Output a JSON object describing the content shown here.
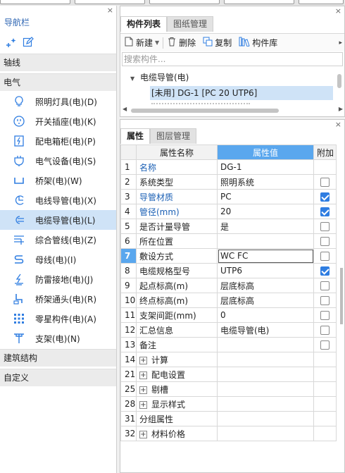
{
  "left_panel": {
    "title": "导航栏",
    "close": "×",
    "categories": {
      "axis": "轴线",
      "electric": "电气",
      "structure": "建筑结构",
      "custom": "自定义"
    },
    "items": [
      {
        "label": "照明灯具(电)(D)",
        "icon": "light-bulb-icon"
      },
      {
        "label": "开关插座(电)(K)",
        "icon": "switch-socket-icon"
      },
      {
        "label": "配电箱柜(电)(P)",
        "icon": "distribution-box-icon"
      },
      {
        "label": "电气设备(电)(S)",
        "icon": "electrical-equipment-icon"
      },
      {
        "label": "桥架(电)(W)",
        "icon": "cable-tray-icon"
      },
      {
        "label": "电线导管(电)(X)",
        "icon": "wire-conduit-icon"
      },
      {
        "label": "电缆导管(电)(L)",
        "icon": "cable-conduit-icon"
      },
      {
        "label": "综合管线(电)(Z)",
        "icon": "integrated-pipeline-icon"
      },
      {
        "label": "母线(电)(I)",
        "icon": "busbar-icon"
      },
      {
        "label": "防雷接地(电)(J)",
        "icon": "lightning-ground-icon"
      },
      {
        "label": "桥架通头(电)(R)",
        "icon": "tray-fitting-icon"
      },
      {
        "label": "零星构件(电)(A)",
        "icon": "misc-component-icon"
      },
      {
        "label": "支架(电)(N)",
        "icon": "bracket-icon"
      }
    ],
    "selected_index": 6
  },
  "component_panel": {
    "tabs": [
      "构件列表",
      "图纸管理"
    ],
    "active_tab": 0,
    "toolbar": {
      "new": "新建",
      "delete": "删除",
      "copy": "复制",
      "library": "构件库"
    },
    "search_placeholder": "搜索构件...",
    "tree_root": "电缆导管(电)",
    "tree_selected": "[未用] DG-1 [PC 20 UTP6]"
  },
  "property_panel": {
    "tabs": [
      "属性",
      "图层管理"
    ],
    "active_tab": 0,
    "headers": {
      "name": "属性名称",
      "value": "属性值",
      "extra": "附加"
    },
    "rows": [
      {
        "num": "1",
        "name": "名称",
        "value": "DG-1",
        "blue": true,
        "check": null
      },
      {
        "num": "2",
        "name": "系统类型",
        "value": "照明系统",
        "blue": false,
        "check": false
      },
      {
        "num": "3",
        "name": "导管材质",
        "value": "PC",
        "blue": true,
        "check": true
      },
      {
        "num": "4",
        "name": "管径(mm)",
        "value": "20",
        "blue": true,
        "check": true
      },
      {
        "num": "5",
        "name": "是否计量导管",
        "value": "是",
        "blue": false,
        "check": false
      },
      {
        "num": "6",
        "name": "所在位置",
        "value": "",
        "blue": false,
        "check": false
      },
      {
        "num": "7",
        "name": "敷设方式",
        "value": "WC FC",
        "blue": false,
        "check": false
      },
      {
        "num": "8",
        "name": "电缆规格型号",
        "value": "UTP6",
        "blue": false,
        "check": true
      },
      {
        "num": "9",
        "name": "起点标高(m)",
        "value": "层底标高",
        "blue": false,
        "check": false
      },
      {
        "num": "10",
        "name": "终点标高(m)",
        "value": "层底标高",
        "blue": false,
        "check": false
      },
      {
        "num": "11",
        "name": "支架间距(mm)",
        "value": "0",
        "blue": false,
        "check": false
      },
      {
        "num": "12",
        "name": "汇总信息",
        "value": "电缆导管(电)",
        "blue": false,
        "check": false
      },
      {
        "num": "13",
        "name": "备注",
        "value": "",
        "blue": false,
        "check": false
      }
    ],
    "current_row": 6,
    "groups": [
      {
        "num": "14",
        "name": "计算",
        "expandable": true
      },
      {
        "num": "21",
        "name": "配电设置",
        "expandable": true
      },
      {
        "num": "25",
        "name": "剔槽",
        "expandable": true
      },
      {
        "num": "28",
        "name": "显示样式",
        "expandable": true
      },
      {
        "num": "31",
        "name": "分组属性",
        "expandable": false
      },
      {
        "num": "32",
        "name": "材料价格",
        "expandable": true
      }
    ]
  }
}
